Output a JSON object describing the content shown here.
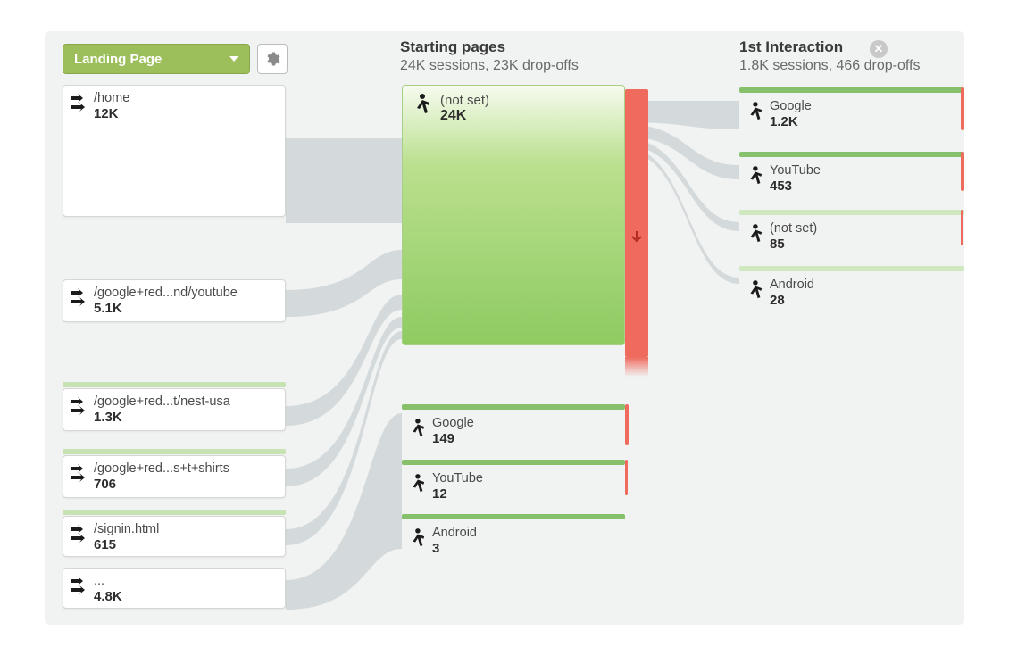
{
  "dimension": {
    "label": "Landing Page"
  },
  "columns": {
    "starting": {
      "title": "Starting pages",
      "subtitle": "24K sessions, 23K drop-offs"
    },
    "first": {
      "title": "1st Interaction",
      "subtitle": "1.8K sessions, 466 drop-offs"
    }
  },
  "landing_nodes": [
    {
      "label": "/home",
      "value": "12K"
    },
    {
      "label": "/google+red...nd/youtube",
      "value": "5.1K"
    },
    {
      "label": "/google+red...t/nest-usa",
      "value": "1.3K"
    },
    {
      "label": "/google+red...s+t+shirts",
      "value": "706"
    },
    {
      "label": "/signin.html",
      "value": "615"
    },
    {
      "label": "...",
      "value": "4.8K"
    }
  ],
  "starting_nodes": [
    {
      "label": "(not set)",
      "value": "24K",
      "big": true
    },
    {
      "label": "Google",
      "value": "149"
    },
    {
      "label": "YouTube",
      "value": "12"
    },
    {
      "label": "Android",
      "value": "3"
    }
  ],
  "interaction_nodes": [
    {
      "label": "Google",
      "value": "1.2K"
    },
    {
      "label": "YouTube",
      "value": "453"
    },
    {
      "label": "(not set)",
      "value": "85"
    },
    {
      "label": "Android",
      "value": "28"
    }
  ]
}
